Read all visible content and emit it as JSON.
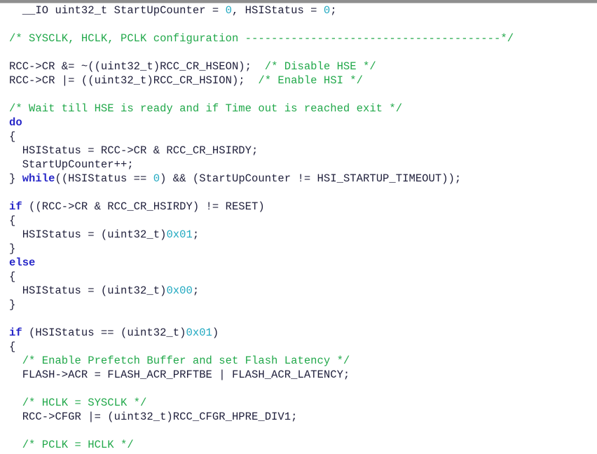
{
  "editor": {
    "language": "C",
    "background_color": "#ffffff",
    "top_band_color": "#8f8f8f",
    "colors": {
      "plain": "#20203c",
      "comment": "#21a84a",
      "keyword": "#2727c8",
      "number": "#1fa8c0"
    }
  },
  "code": {
    "lines": [
      {
        "index": 1,
        "tokens": [
          {
            "t": "  __IO uint32_t StartUpCounter = ",
            "c": "plain"
          },
          {
            "t": "0",
            "c": "number"
          },
          {
            "t": ", HSIStatus = ",
            "c": "plain"
          },
          {
            "t": "0",
            "c": "number"
          },
          {
            "t": ";",
            "c": "plain"
          }
        ]
      },
      {
        "index": 2,
        "tokens": []
      },
      {
        "index": 3,
        "tokens": [
          {
            "t": "/* SYSCLK, HCLK, PCLK configuration ---------------------------------------*/",
            "c": "comment"
          }
        ]
      },
      {
        "index": 4,
        "tokens": []
      },
      {
        "index": 5,
        "tokens": [
          {
            "t": "RCC->CR &= ~((uint32_t)RCC_CR_HSEON);  ",
            "c": "plain"
          },
          {
            "t": "/* Disable HSE */",
            "c": "comment"
          }
        ]
      },
      {
        "index": 6,
        "tokens": [
          {
            "t": "RCC->CR |= ((uint32_t)RCC_CR_HSION);  ",
            "c": "plain"
          },
          {
            "t": "/* Enable HSI */",
            "c": "comment"
          }
        ]
      },
      {
        "index": 7,
        "tokens": []
      },
      {
        "index": 8,
        "tokens": [
          {
            "t": "/* Wait till HSE is ready and if Time out is reached exit */",
            "c": "comment"
          }
        ]
      },
      {
        "index": 9,
        "tokens": [
          {
            "t": "do",
            "c": "keyword"
          }
        ]
      },
      {
        "index": 10,
        "tokens": [
          {
            "t": "{",
            "c": "plain"
          }
        ]
      },
      {
        "index": 11,
        "tokens": [
          {
            "t": "  HSIStatus = RCC->CR & RCC_CR_HSIRDY;",
            "c": "plain"
          }
        ]
      },
      {
        "index": 12,
        "tokens": [
          {
            "t": "  StartUpCounter++;",
            "c": "plain"
          }
        ]
      },
      {
        "index": 13,
        "tokens": [
          {
            "t": "} ",
            "c": "plain"
          },
          {
            "t": "while",
            "c": "keyword"
          },
          {
            "t": "((HSIStatus == ",
            "c": "plain"
          },
          {
            "t": "0",
            "c": "number"
          },
          {
            "t": ") && (StartUpCounter != HSI_STARTUP_TIMEOUT));",
            "c": "plain"
          }
        ]
      },
      {
        "index": 14,
        "tokens": []
      },
      {
        "index": 15,
        "tokens": [
          {
            "t": "if",
            "c": "keyword"
          },
          {
            "t": " ((RCC->CR & RCC_CR_HSIRDY) != RESET)",
            "c": "plain"
          }
        ]
      },
      {
        "index": 16,
        "tokens": [
          {
            "t": "{",
            "c": "plain"
          }
        ]
      },
      {
        "index": 17,
        "tokens": [
          {
            "t": "  HSIStatus = (uint32_t)",
            "c": "plain"
          },
          {
            "t": "0x01",
            "c": "number"
          },
          {
            "t": ";",
            "c": "plain"
          }
        ]
      },
      {
        "index": 18,
        "tokens": [
          {
            "t": "}",
            "c": "plain"
          }
        ]
      },
      {
        "index": 19,
        "tokens": [
          {
            "t": "else",
            "c": "keyword"
          }
        ]
      },
      {
        "index": 20,
        "tokens": [
          {
            "t": "{",
            "c": "plain"
          }
        ]
      },
      {
        "index": 21,
        "tokens": [
          {
            "t": "  HSIStatus = (uint32_t)",
            "c": "plain"
          },
          {
            "t": "0x00",
            "c": "number"
          },
          {
            "t": ";",
            "c": "plain"
          }
        ]
      },
      {
        "index": 22,
        "tokens": [
          {
            "t": "}",
            "c": "plain"
          }
        ]
      },
      {
        "index": 23,
        "tokens": []
      },
      {
        "index": 24,
        "tokens": [
          {
            "t": "if",
            "c": "keyword"
          },
          {
            "t": " (HSIStatus == (uint32_t)",
            "c": "plain"
          },
          {
            "t": "0x01",
            "c": "number"
          },
          {
            "t": ")",
            "c": "plain"
          }
        ]
      },
      {
        "index": 25,
        "tokens": [
          {
            "t": "{",
            "c": "plain"
          }
        ]
      },
      {
        "index": 26,
        "tokens": [
          {
            "t": "  ",
            "c": "plain"
          },
          {
            "t": "/* Enable Prefetch Buffer and set Flash Latency */",
            "c": "comment"
          }
        ]
      },
      {
        "index": 27,
        "tokens": [
          {
            "t": "  FLASH->ACR = FLASH_ACR_PRFTBE | FLASH_ACR_LATENCY;",
            "c": "plain"
          }
        ]
      },
      {
        "index": 28,
        "tokens": []
      },
      {
        "index": 29,
        "tokens": [
          {
            "t": "  ",
            "c": "plain"
          },
          {
            "t": "/* HCLK = SYSCLK */",
            "c": "comment"
          }
        ]
      },
      {
        "index": 30,
        "tokens": [
          {
            "t": "  RCC->CFGR |= (uint32_t)RCC_CFGR_HPRE_DIV1;",
            "c": "plain"
          }
        ]
      },
      {
        "index": 31,
        "tokens": []
      },
      {
        "index": 32,
        "tokens": [
          {
            "t": "  ",
            "c": "plain"
          },
          {
            "t": "/* PCLK = HCLK */",
            "c": "comment"
          }
        ]
      }
    ]
  }
}
